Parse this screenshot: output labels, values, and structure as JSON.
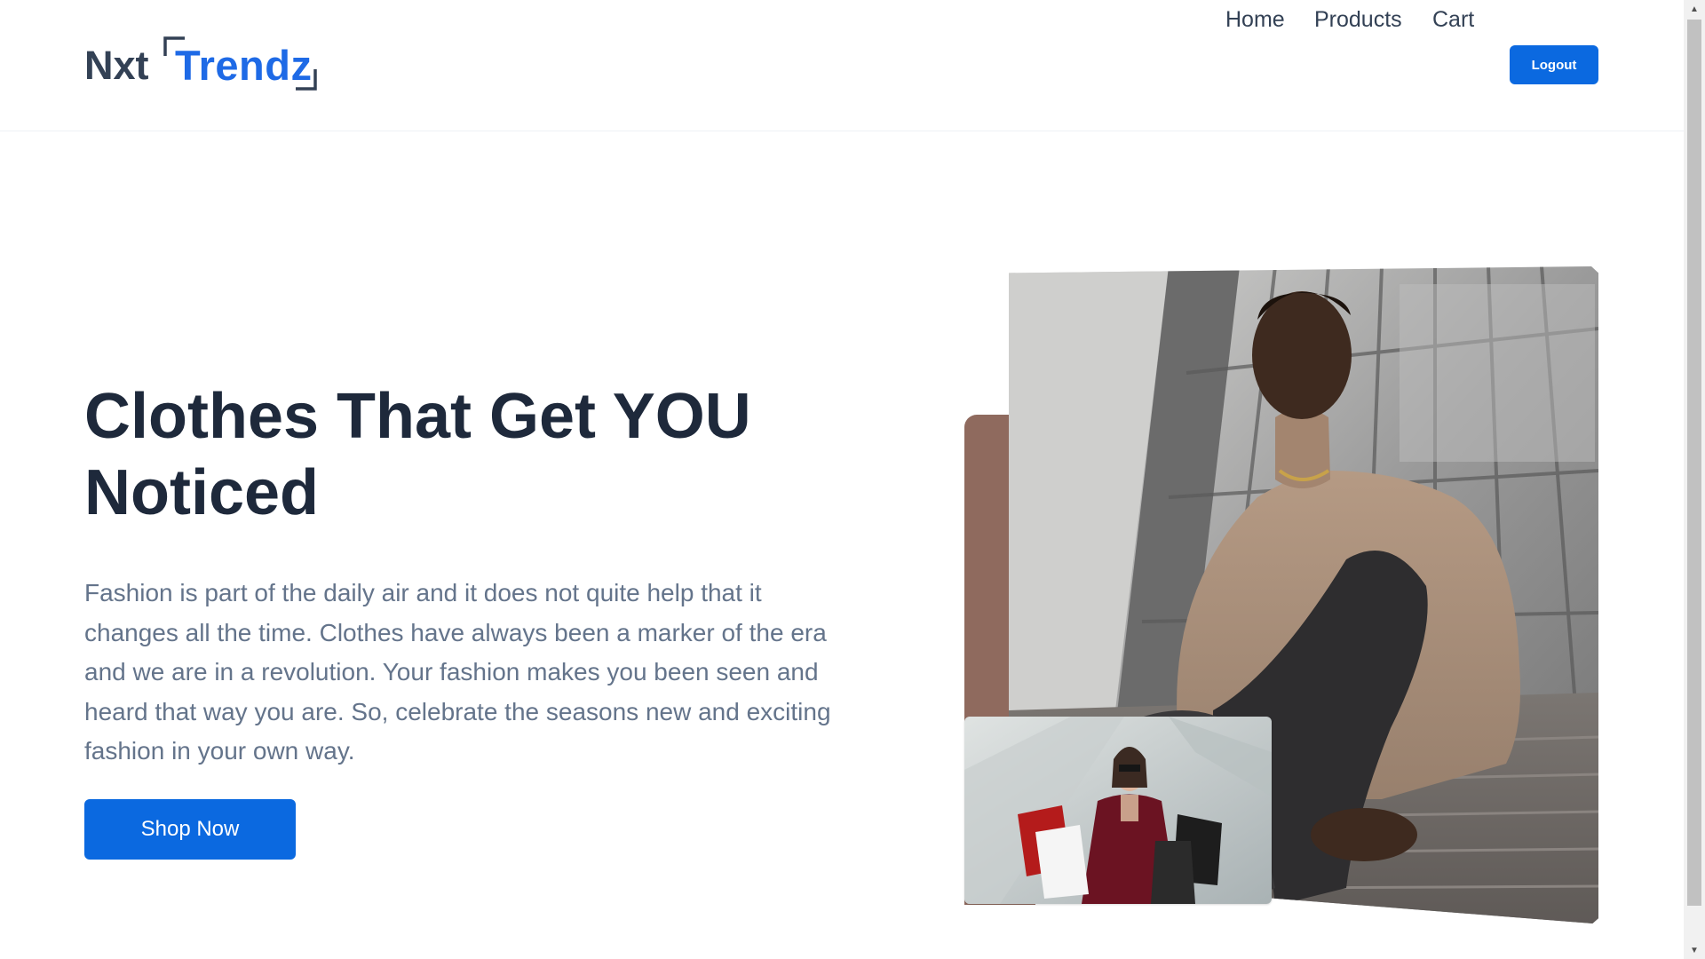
{
  "nav": {
    "logo_part1": "Nxt",
    "logo_part2": "Trendz",
    "links": [
      "Home",
      "Products",
      "Cart"
    ],
    "logout_label": "Logout"
  },
  "hero": {
    "heading": "Clothes That Get YOU Noticed",
    "description": "Fashion is part of the daily air and it does not quite help that it changes all the time. Clothes have always been a marker of the era and we are in a revolution. Your fashion makes you been seen and heard that way you are. So, celebrate the seasons new and exciting fashion in your own way.",
    "cta_label": "Shop Now"
  },
  "colors": {
    "primary": "#0b69e0",
    "logo_accent": "#1e6ae6",
    "heading": "#1e293b",
    "body_text": "#64748b",
    "nav_text": "#334155",
    "brown_accent": "#8f6a5e"
  },
  "icons": {
    "scroll_up": "scroll-up-arrow-icon",
    "scroll_down": "scroll-down-arrow-icon"
  }
}
